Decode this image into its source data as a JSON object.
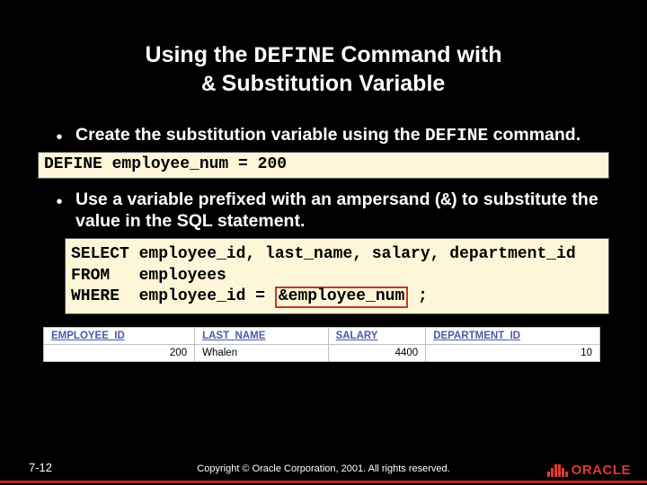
{
  "title": {
    "line1_pre": "Using the ",
    "line1_mono": "DEFINE",
    "line1_post": " Command with",
    "line2_mono": "&",
    "line2_post": " Substitution Variable"
  },
  "bullets": [
    {
      "pre": "Create the substitution variable using the ",
      "mono": "DEFINE",
      "post": " command."
    },
    {
      "pre": "Use a variable prefixed with an ampersand (",
      "mono": "&",
      "post": ") to substitute the value in the SQL statement."
    }
  ],
  "code": {
    "define": "DEFINE employee_num = 200",
    "select_l1": "SELECT employee_id, last_name, salary, department_id",
    "select_l2": "FROM   employees",
    "select_l3_pre": "WHERE  employee_id = ",
    "select_l3_hl": "&employee_num",
    "select_l3_post": " ;"
  },
  "result": {
    "headers": [
      "EMPLOYEE_ID",
      "LAST_NAME",
      "SALARY",
      "DEPARTMENT_ID"
    ],
    "row": {
      "employee_id": "200",
      "last_name": "Whalen",
      "salary": "4400",
      "department_id": "10"
    }
  },
  "footer": {
    "pageno": "7-12",
    "copyright": "Copyright © Oracle Corporation, 2001. All rights reserved.",
    "brand": "ORACLE"
  }
}
